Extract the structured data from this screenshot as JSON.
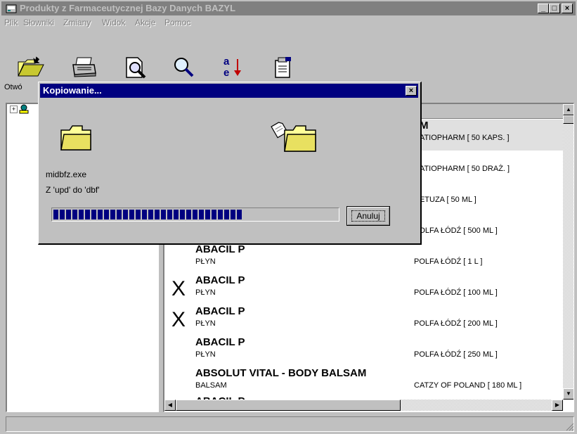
{
  "window": {
    "title": "Produkty z Farmaceutycznej Bazy Danych BAZYL",
    "controls": [
      "_",
      "□",
      "×"
    ]
  },
  "menu": [
    "Plik",
    "Słowniki",
    "Zmiany",
    "Widok",
    "Akcje",
    "Pomoc"
  ],
  "toolbar": [
    {
      "icon": "open-folder-icon",
      "label": "Otwó"
    },
    {
      "icon": "printer-icon",
      "label": ""
    },
    {
      "icon": "print-preview-icon",
      "label": ""
    },
    {
      "icon": "search-icon",
      "label": ""
    },
    {
      "icon": "sort-ae-icon",
      "label": ""
    },
    {
      "icon": "properties-icon",
      "label": ""
    }
  ],
  "list": {
    "rows": [
      {
        "name": "M",
        "form": "",
        "maker": "RATIOPHARM [ 50 KAPS. ]",
        "selected": true,
        "mark": ""
      },
      {
        "name": "",
        "form": "",
        "maker": "RATIOPHARM [ 50 DRAŻ. ]",
        "selected": false,
        "mark": ""
      },
      {
        "name": "",
        "form": "",
        "maker": "CETUZA [ 50 ML ]",
        "selected": false,
        "mark": ""
      },
      {
        "name": "",
        "form": "",
        "maker": "POLFA ŁÓDŹ [ 500 ML ]",
        "selected": false,
        "mark": ""
      },
      {
        "name": "ABACIL P",
        "form": "PŁYN",
        "maker": "POLFA ŁÓDŹ [ 1 L ]",
        "selected": false,
        "mark": ""
      },
      {
        "name": "ABACIL P",
        "form": "PŁYN",
        "maker": "POLFA ŁÓDŹ [ 100 ML ]",
        "selected": false,
        "mark": "X"
      },
      {
        "name": "ABACIL P",
        "form": "PŁYN",
        "maker": "POLFA ŁÓDŹ [ 200 ML ]",
        "selected": false,
        "mark": "X"
      },
      {
        "name": "ABACIL P",
        "form": "PŁYN",
        "maker": "POLFA ŁÓDŹ [ 250 ML ]",
        "selected": false,
        "mark": ""
      },
      {
        "name": "ABSOLUT VITAL - BODY BALSAM",
        "form": "BALSAM",
        "maker": "CATZY OF POLAND [ 180 ML ]",
        "selected": false,
        "mark": ""
      },
      {
        "name": "ABACIL P",
        "form": "",
        "maker": "",
        "selected": false,
        "mark": ""
      }
    ]
  },
  "dialog": {
    "title": "Kopiowanie...",
    "file": "midbfz.exe",
    "path": "Z 'upd' do 'dbf'",
    "progress": 0.68,
    "cancel_label": "Anuluj"
  },
  "colors": {
    "dialog_title_bg": "#000080",
    "window_title_bg": "#808080",
    "progress_fill": "#000080",
    "face": "#c0c0c0"
  }
}
